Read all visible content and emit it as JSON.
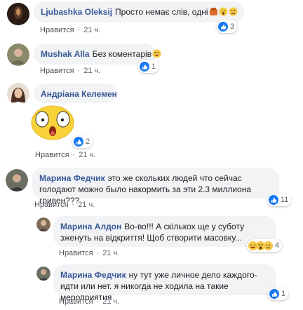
{
  "like_label": "Нравится",
  "comments": [
    {
      "author": "Ljubashka Oleksij",
      "text": "Просто немає слів, одні",
      "time": "21 ч.",
      "reaction_count": "3"
    },
    {
      "author": "Mushak Alla",
      "text": "Без коментарів",
      "time": "21 ч.",
      "reaction_count": "1"
    },
    {
      "author": "Андріана Келемен",
      "text": "",
      "time": "21 ч.",
      "reaction_count": "2"
    },
    {
      "author": "Марина Федчик",
      "text": "это же скольких людей что сейчас голодают можно было накормить за эти 2.3 миллиона гривен???",
      "time": "21 ч.",
      "reaction_count": "11"
    }
  ],
  "replies": [
    {
      "author": "Марина Алдон",
      "text": "Во-во!!! А скількох ще у суботу зженуть на відкриття! Щоб створити масовку...",
      "time": "21 ч.",
      "reaction_count": "4"
    },
    {
      "author": "Марина Федчик",
      "text": "ну тут уже личное дело каждого- идти или нет. я никогда не ходила на такие мероприятия",
      "time": "21 ч.",
      "reaction_count": "1"
    }
  ]
}
